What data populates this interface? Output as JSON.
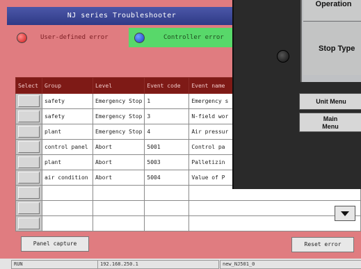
{
  "window": {
    "title": "NJ series Troubleshooter"
  },
  "tabs": [
    {
      "label": "User-defined error",
      "dot_color": "#d11a1a",
      "active": true
    },
    {
      "label": "Controller error",
      "dot_color": "#1a3fc6",
      "active": false
    }
  ],
  "table": {
    "headers": [
      "Select",
      "Group",
      "Level",
      "Event code",
      "Event name"
    ],
    "rows": [
      {
        "group": "safety",
        "level": "Emergency Stop",
        "code": "1",
        "name": "Emergency s"
      },
      {
        "group": "safety",
        "level": "Emergency Stop",
        "code": "3",
        "name": "N-field wor"
      },
      {
        "group": "plant",
        "level": "Emergency Stop",
        "code": "4",
        "name": "Air pressur"
      },
      {
        "group": "control panel",
        "level": "Abort",
        "code": "5001",
        "name": "Control pa"
      },
      {
        "group": "plant",
        "level": "Abort",
        "code": "5003",
        "name": "Palletizin"
      },
      {
        "group": "air condition",
        "level": "Abort",
        "code": "5004",
        "name": "Value of P"
      },
      {
        "group": "",
        "level": "",
        "code": "",
        "name": ""
      },
      {
        "group": "",
        "level": "",
        "code": "",
        "name": ""
      },
      {
        "group": "",
        "level": "",
        "code": "",
        "name": ""
      }
    ]
  },
  "buttons": {
    "panel_capture": "Panel capture",
    "reset_error": "Reset error"
  },
  "status": {
    "run": "RUN",
    "ip": "192.168.250.1",
    "device": "new_NJ501_0"
  },
  "hmi": {
    "operation_label": "Operation",
    "stop_type_label": "Stop Type",
    "unit_menu": "Unit Menu",
    "main_menu_line1": "Main",
    "main_menu_line2": "Menu"
  },
  "colors": {
    "background": "#e07c80",
    "header": "#7e1a16",
    "title_bar": "#3b469a",
    "controller_tab": "#58d86a"
  }
}
